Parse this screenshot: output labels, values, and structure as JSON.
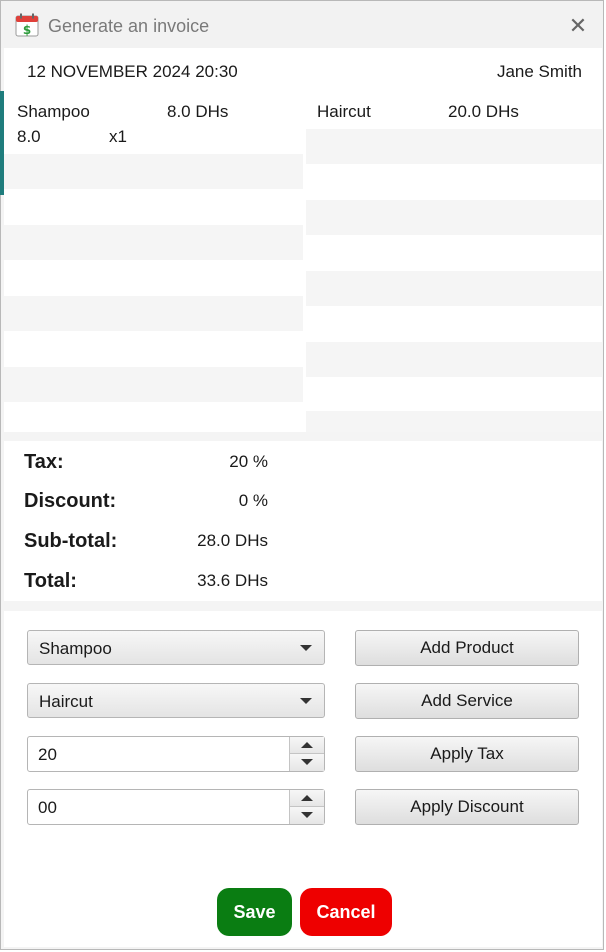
{
  "window": {
    "title": "Generate an invoice",
    "icon": "dollar-calendar-icon",
    "close_glyph": "✕"
  },
  "header": {
    "date": "12 NOVEMBER 2024 20:30",
    "client": "Jane Smith"
  },
  "products": [
    {
      "name": "Shampoo",
      "price": "8.0 DHs",
      "unit_price": "8.0",
      "quantity": "x1"
    }
  ],
  "services": [
    {
      "name": "Haircut",
      "price": "20.0 DHs"
    }
  ],
  "totals": {
    "tax_label": "Tax:",
    "tax_value": "20 %",
    "discount_label": "Discount:",
    "discount_value": "0 %",
    "subtotal_label": "Sub-total:",
    "subtotal_value": "28.0 DHs",
    "total_label": "Total:",
    "total_value": "33.6 DHs"
  },
  "controls": {
    "product_select": "Shampoo",
    "service_select": "Haircut",
    "tax_input": "20",
    "discount_input": "00",
    "add_product_label": "Add Product",
    "add_service_label": "Add Service",
    "apply_tax_label": "Apply Tax",
    "apply_discount_label": "Apply Discount"
  },
  "actions": {
    "save_label": "Save",
    "cancel_label": "Cancel"
  },
  "colors": {
    "save": "#0a7d12",
    "cancel": "#ee0000",
    "edge_accent": "#1f7d7d"
  }
}
